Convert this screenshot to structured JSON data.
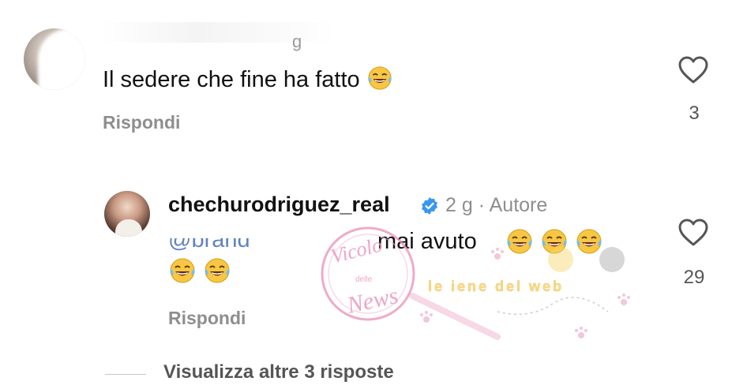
{
  "comment1": {
    "time": "g",
    "text": "Il sedere che fine ha fatto",
    "emoji": "face-with-tears-of-joy",
    "reply_label": "Rispondi",
    "likes": "3"
  },
  "comment2": {
    "username": "chechurodriguez_real",
    "time": "2 g",
    "separator": "·",
    "author_label": "Autore",
    "mention": "@brand",
    "text": "mai avuto",
    "emoji": "face-with-tears-of-joy",
    "reply_label": "Rispondi",
    "likes": "29"
  },
  "view_more": "Visualizza altre 3 risposte",
  "watermarks": {
    "left": "Vicolo delle News",
    "right": "le iene del web"
  },
  "colors": {
    "text": "#111111",
    "secondary": "#8e8e8e",
    "verified": "#3897f0",
    "mention": "#2b59a8",
    "watermark_pink": "#e98fb7"
  }
}
